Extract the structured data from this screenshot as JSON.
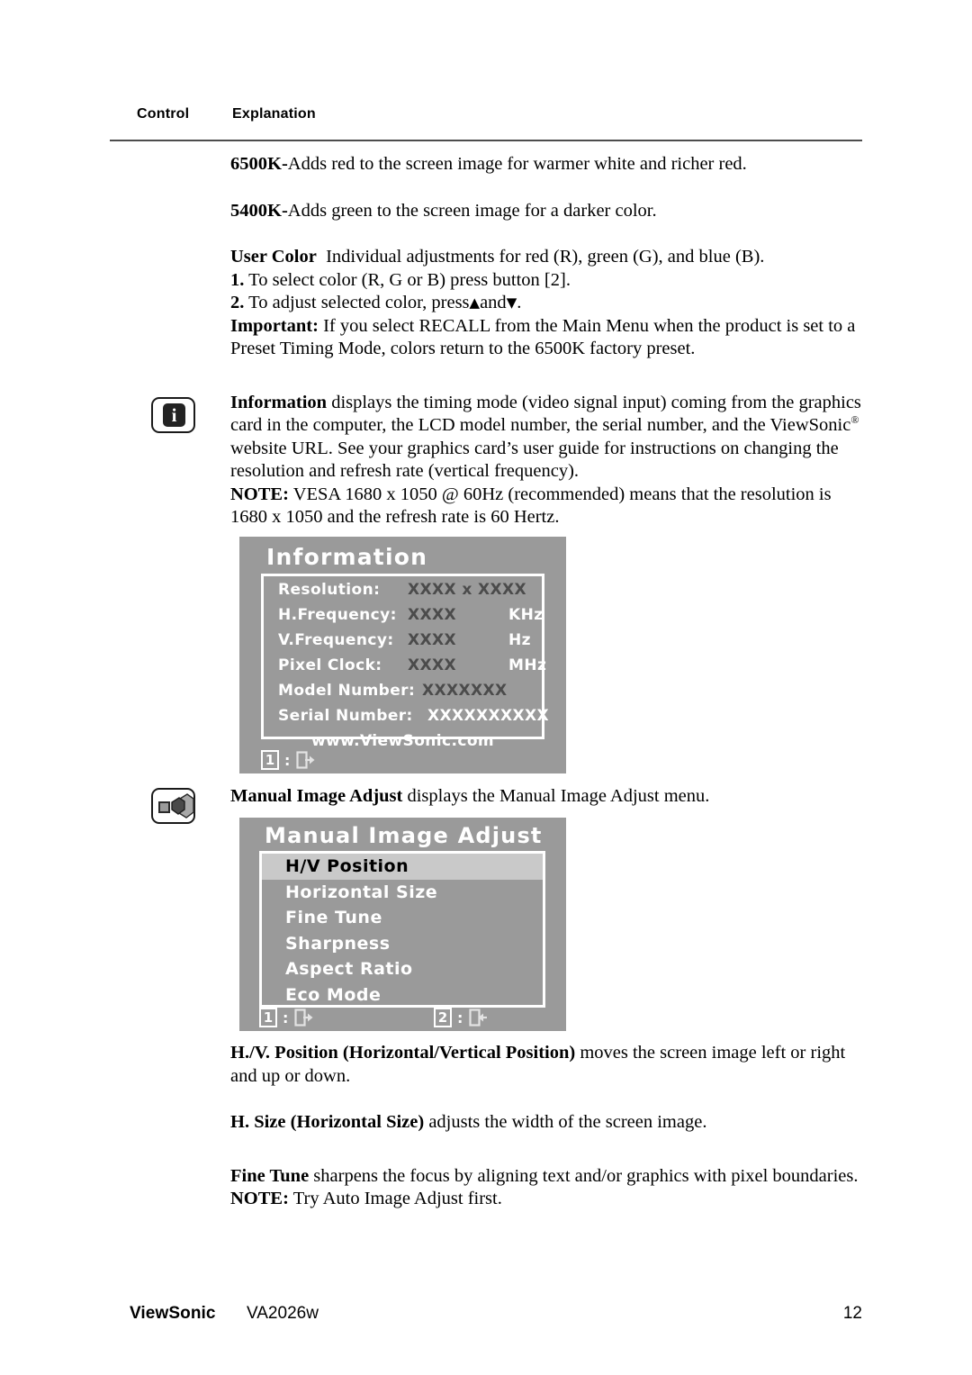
{
  "header": {
    "col_control": "Control",
    "col_explanation": "Explanation"
  },
  "body": {
    "p_6500k_bold": "6500K-",
    "p_6500k_rest": "Adds red to the screen image for warmer white and richer red.",
    "p_5400k_bold": "5400K-",
    "p_5400k_rest": "Adds green to the screen image for a darker color.",
    "user_color_bold": "User Color",
    "user_color_rest": "Individual adjustments for red (R), green (G),  and blue (B).",
    "step1_num": "1.",
    "step1_text": "To select color (R, G or B) press button [2].",
    "step2_num": "2.",
    "step2_text_a": "To adjust selected color, press",
    "step2_up": "▲",
    "step2_and": "and",
    "step2_down": "▼",
    "step2_text_b": ".",
    "important_bold": "Important:",
    "important_rest": "If you select RECALL from the Main Menu when the product is set to a Preset Timing Mode, colors return to the 6500K factory preset.",
    "information_bold": "Information",
    "information_rest_a": "displays the timing mode (video signal input) coming from the graphics card in the computer, the LCD model number, the serial number, and the ViewSonic",
    "information_reg": "®",
    "information_rest_b": "website URL. See your graphics card’s user guide for instructions on changing the resolution and refresh rate (vertical frequency).",
    "note_vesa_bold": "NOTE:",
    "note_vesa_rest": "VESA 1680 x 1050 @ 60Hz (recommended) means that the resolution is 1680 x 1050 and the refresh rate is 60 Hertz.",
    "mia_bold": "Manual Image Adjust",
    "mia_rest": "displays the Manual Image Adjust menu.",
    "hv_bold": "H./V. Position (Horizontal/Vertical Position)",
    "hv_rest": "moves the screen image left or right and up or down.",
    "hsize_bold": "H. Size (Horizontal Size)",
    "hsize_rest": "adjusts the width of the screen image.",
    "finetune_bold": "Fine Tune",
    "finetune_rest": "sharpens the focus by aligning text and/or graphics with pixel boundaries.",
    "note_auto_bold": "NOTE:",
    "note_auto_rest": "Try Auto Image Adjust first."
  },
  "icons": {
    "info_glyph": "i"
  },
  "osd_information": {
    "title": "Information",
    "rows": [
      {
        "label": "Resolution:",
        "value": "XXXX x XXXX",
        "unit": "",
        "value_tone": "dark"
      },
      {
        "label": "H.Frequency:",
        "value": "XXXX",
        "unit": "KHz",
        "value_tone": "dark"
      },
      {
        "label": "V.Frequency:",
        "value": "XXXX",
        "unit": "Hz",
        "value_tone": "dark"
      },
      {
        "label": "Pixel Clock:",
        "value": "XXXX",
        "unit": "MHz",
        "value_tone": "dark"
      },
      {
        "label": "Model Number:",
        "value": "XXXXXXX",
        "unit": "",
        "value_tone": "dark"
      },
      {
        "label": "Serial Number:",
        "value": "XXXXXXXXXX",
        "unit": "",
        "value_tone": "light"
      }
    ],
    "url": "www.ViewSonic.com",
    "hints": [
      {
        "key": "1",
        "colon": ":",
        "icon": "exit-icon"
      }
    ]
  },
  "osd_manual_image_adjust": {
    "title": "Manual Image Adjust",
    "items": [
      {
        "label": "H/V Position",
        "selected": true
      },
      {
        "label": "Horizontal Size",
        "selected": false
      },
      {
        "label": "Fine Tune",
        "selected": false
      },
      {
        "label": "Sharpness",
        "selected": false
      },
      {
        "label": "Aspect Ratio",
        "selected": false
      },
      {
        "label": "Eco Mode",
        "selected": false
      }
    ],
    "hints": [
      {
        "key": "1",
        "colon": ":",
        "icon": "exit-icon"
      },
      {
        "key": "2",
        "colon": ":",
        "icon": "enter-icon"
      }
    ]
  },
  "footer": {
    "brand": "ViewSonic",
    "model": "VA2026w",
    "page_number": "12"
  },
  "colors": {
    "osd_background": "#9a9a9a",
    "osd_border": "#ffffff",
    "osd_selected_row": "#c9c9c9",
    "osd_value_dark": "#4b4b4b",
    "rule": "#4d4d4d"
  }
}
